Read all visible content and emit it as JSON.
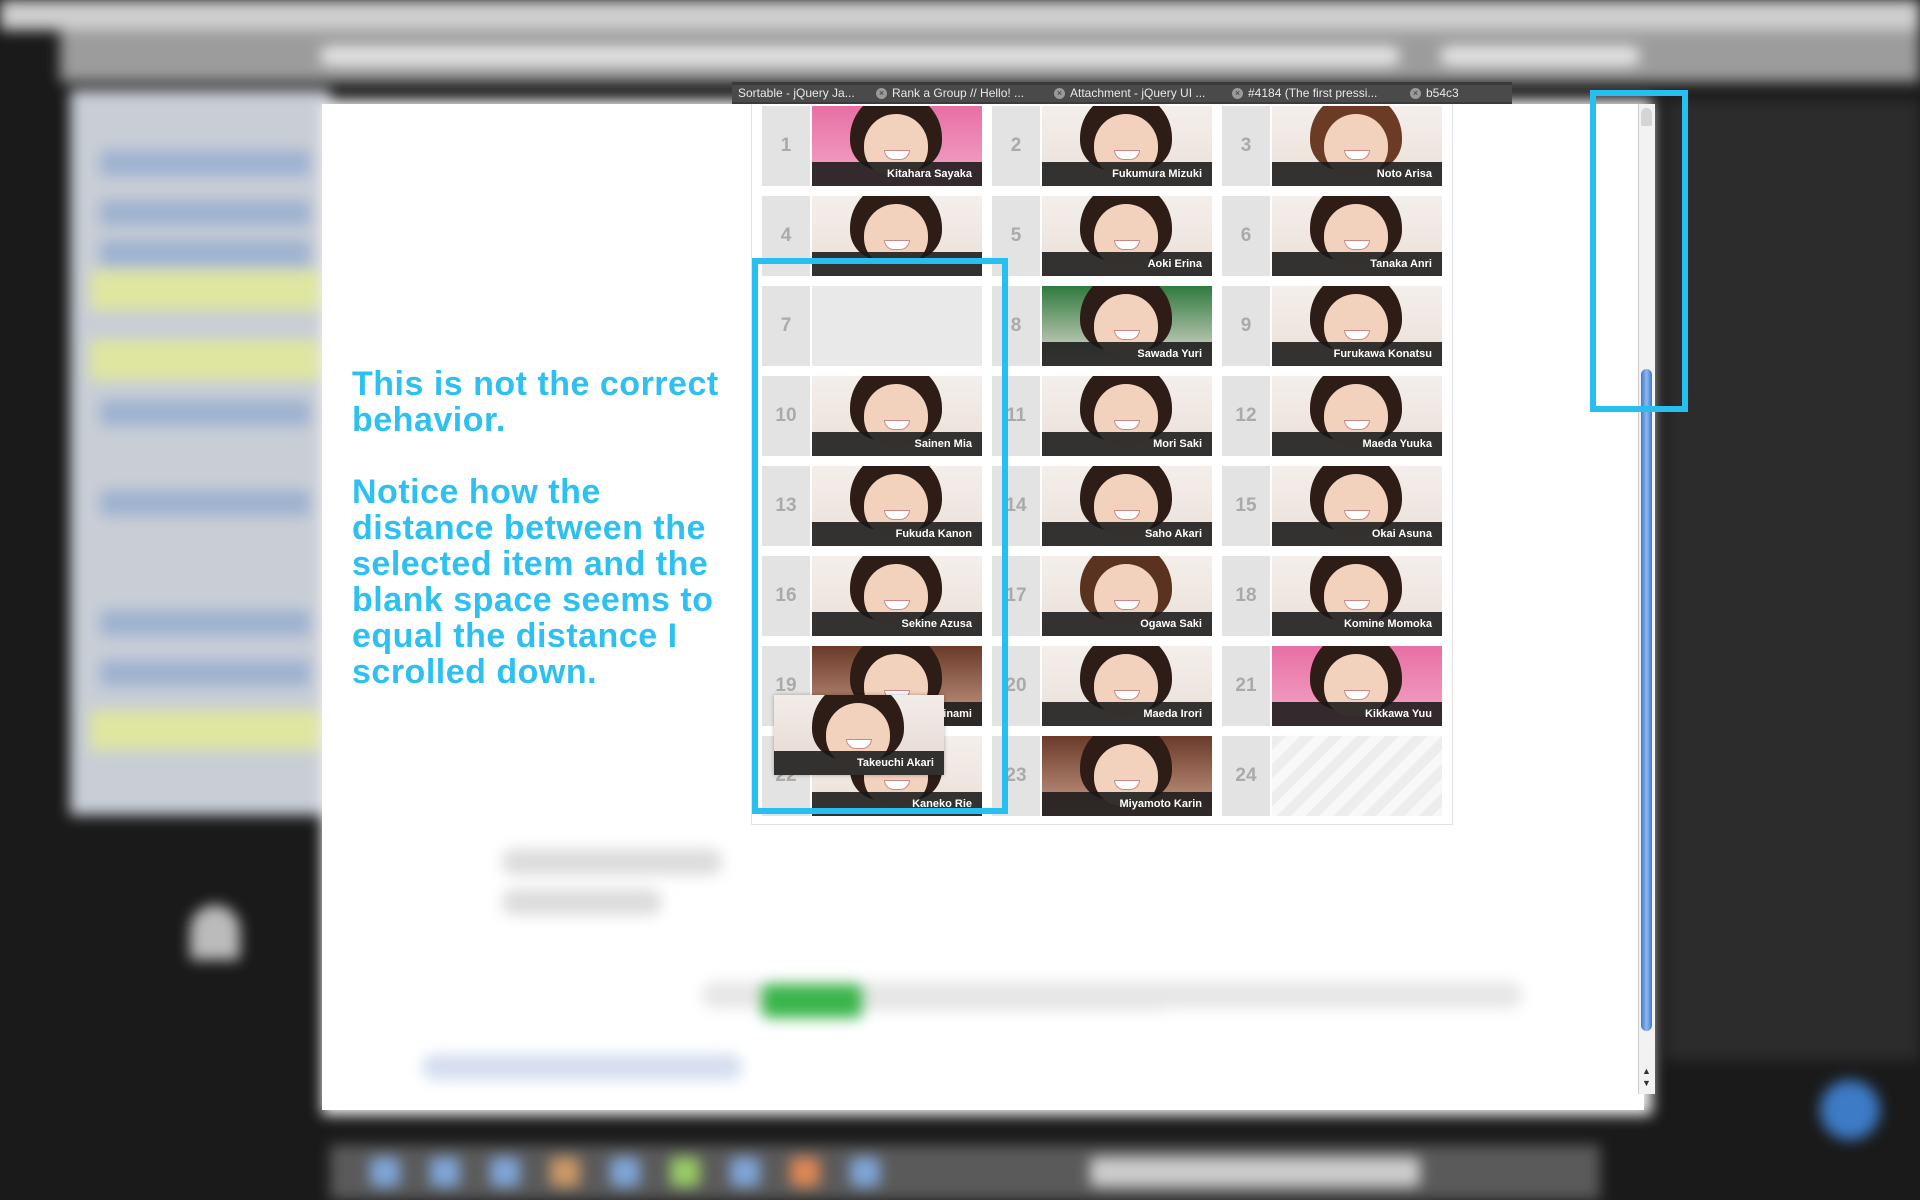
{
  "tabs": [
    {
      "label": "Sortable - jQuery Ja..."
    },
    {
      "label": "Rank a Group // Hello! ..."
    },
    {
      "label": "Attachment - jQuery UI ..."
    },
    {
      "label": "#4184 (The first pressi..."
    },
    {
      "label": "b54c3"
    }
  ],
  "annotation": {
    "line1": "This is not the correct behavior.",
    "line2": "Notice how the distance between the selected item and the blank space seems to equal the distance I scrolled down."
  },
  "grid": {
    "cells": [
      {
        "number": "1",
        "name": "Kitahara Sayaka"
      },
      {
        "number": "2",
        "name": "Fukumura Mizuki"
      },
      {
        "number": "3",
        "name": "Noto Arisa"
      },
      {
        "number": "4",
        "name": ""
      },
      {
        "number": "5",
        "name": "Aoki Erina"
      },
      {
        "number": "6",
        "name": "Tanaka Anri"
      },
      {
        "number": "7",
        "name": ""
      },
      {
        "number": "8",
        "name": "Sawada Yuri"
      },
      {
        "number": "9",
        "name": "Furukawa Konatsu"
      },
      {
        "number": "10",
        "name": "Sainen Mia"
      },
      {
        "number": "11",
        "name": "Mori Saki"
      },
      {
        "number": "12",
        "name": "Maeda Yuuka"
      },
      {
        "number": "13",
        "name": "Fukuda Kanon"
      },
      {
        "number": "14",
        "name": "Saho Akari"
      },
      {
        "number": "15",
        "name": "Okai Asuna"
      },
      {
        "number": "16",
        "name": "Sekine Azusa"
      },
      {
        "number": "17",
        "name": "Ogawa Saki"
      },
      {
        "number": "18",
        "name": "Komine Momoka"
      },
      {
        "number": "19",
        "name": "...inami"
      },
      {
        "number": "20",
        "name": "Maeda Irori"
      },
      {
        "number": "21",
        "name": "Kikkawa Yuu"
      },
      {
        "number": "22",
        "name": "Kaneko Rie"
      },
      {
        "number": "23",
        "name": "Miyamoto Karin"
      },
      {
        "number": "24",
        "name": ""
      }
    ],
    "dragged_item": {
      "name": "Takeuchi Akari"
    }
  }
}
